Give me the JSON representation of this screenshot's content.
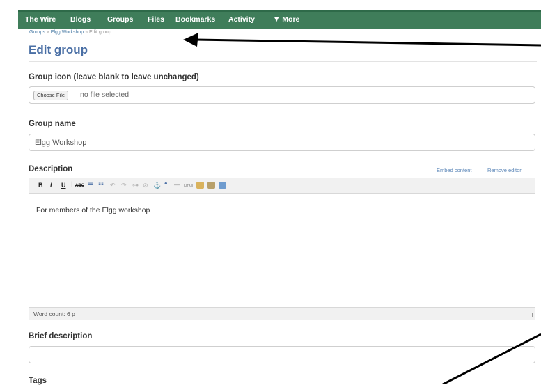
{
  "nav": {
    "items": [
      "The Wire",
      "Blogs",
      "Groups",
      "Files",
      "Bookmarks",
      "Activity",
      "▼ More"
    ]
  },
  "breadcrumb": {
    "groups": "Groups",
    "group": "Elgg Workshop",
    "current": "Edit group",
    "sep": "»"
  },
  "page_title": "Edit group",
  "form": {
    "icon_label": "Group icon (leave blank to leave unchanged)",
    "file_button": "Choose File",
    "file_status": "no file selected",
    "name_label": "Group name",
    "name_value": "Elgg Workshop",
    "description_label": "Description",
    "embed_link": "Embed content",
    "remove_editor_link": "Remove editor",
    "editor_text": "For members of the Elgg workshop",
    "word_count": "Word count: 6 p",
    "brief_label": "Brief description",
    "brief_value": "",
    "tags_label": "Tags"
  },
  "toolbar": {
    "bold": "B",
    "italic": "I",
    "underline": "U",
    "strike": "ABC"
  },
  "colors": {
    "nav_bg": "#3f7d5a",
    "title": "#4a6fa5",
    "link": "#5b86b8"
  },
  "icons": [
    "bold-icon",
    "italic-icon",
    "underline-icon",
    "strikethrough-icon",
    "bullet-list-icon",
    "numbered-list-icon",
    "undo-icon",
    "redo-icon",
    "link-icon",
    "unlink-icon",
    "anchor-icon",
    "image-icon",
    "blockquote-icon",
    "html-icon",
    "paste-text-icon",
    "paste-word-icon",
    "fullscreen-icon"
  ]
}
